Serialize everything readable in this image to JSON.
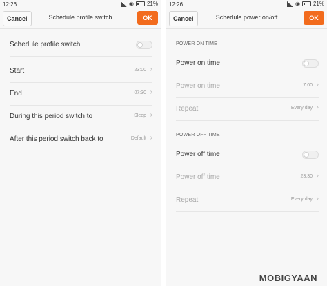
{
  "left": {
    "status": {
      "time": "12:26",
      "battery": "21%"
    },
    "cancel_label": "Cancel",
    "title": "Schedule profile switch",
    "ok_label": "OK",
    "rows": [
      {
        "label": "Schedule profile switch",
        "value": ""
      },
      {
        "label": "Start",
        "value": "23:00"
      },
      {
        "label": "End",
        "value": "07:30"
      },
      {
        "label": "During this period switch to",
        "value": "Sleep"
      },
      {
        "label": "After this period switch back to",
        "value": "Default"
      }
    ]
  },
  "right": {
    "status": {
      "time": "12:26",
      "battery": "21%"
    },
    "cancel_label": "Cancel",
    "title": "Schedule power on/off",
    "ok_label": "OK",
    "power_on": {
      "header": "POWER ON TIME",
      "toggle_label": "Power on time",
      "time_label": "Power on time",
      "time_value": "7:00",
      "repeat_label": "Repeat",
      "repeat_value": "Every day"
    },
    "power_off": {
      "header": "POWER OFF TIME",
      "toggle_label": "Power off time",
      "time_label": "Power off time",
      "time_value": "23:30",
      "repeat_label": "Repeat",
      "repeat_value": "Every day"
    }
  },
  "watermark": "MOBIGYAAN",
  "colors": {
    "ok_button": "#f26b1d",
    "background": "#f7f7f7"
  }
}
